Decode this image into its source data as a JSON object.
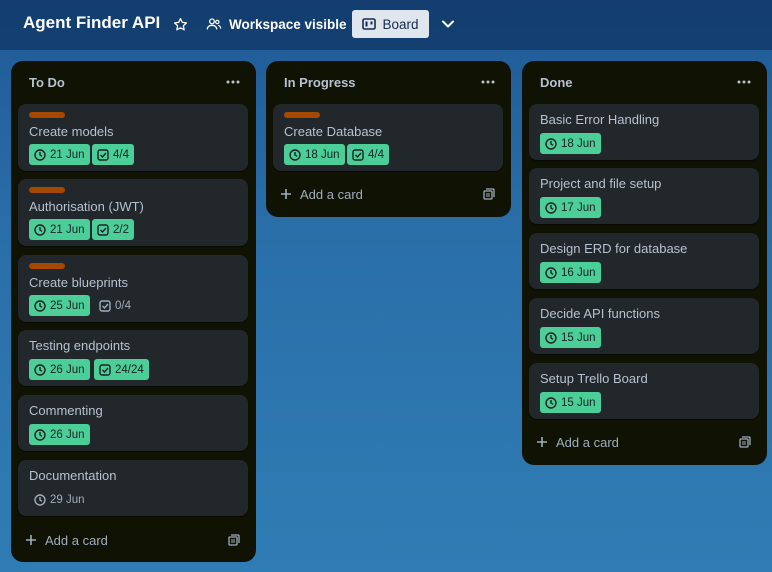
{
  "header": {
    "board_title": "Agent Finder API",
    "visibility_label": "Workspace visible",
    "view_label": "Board"
  },
  "lists": [
    {
      "title": "To Do",
      "add_card_label": "Add a card",
      "cards": [
        {
          "title": "Create models",
          "label_color": "#a54800",
          "due": "21 Jun",
          "checklist": "4/4",
          "checklist_complete": true
        },
        {
          "title": "Authorisation (JWT)",
          "label_color": "#a54800",
          "due": "21 Jun",
          "checklist": "2/2",
          "checklist_complete": true
        },
        {
          "title": "Create blueprints",
          "label_color": "#a54800",
          "due": "25 Jun",
          "checklist": "0/4",
          "checklist_complete": false
        },
        {
          "title": "Testing endpoints",
          "due": "26 Jun",
          "checklist": "24/24",
          "checklist_complete": true
        },
        {
          "title": "Commenting",
          "due": "26 Jun"
        },
        {
          "title": "Documentation",
          "due": "29 Jun",
          "due_complete": false
        }
      ]
    },
    {
      "title": "In Progress",
      "add_card_label": "Add a card",
      "cards": [
        {
          "title": "Create Database",
          "label_color": "#a54800",
          "due": "18 Jun",
          "checklist": "4/4",
          "checklist_complete": true
        }
      ]
    },
    {
      "title": "Done",
      "add_card_label": "Add a card",
      "cards": [
        {
          "title": "Basic Error Handling",
          "due": "18 Jun"
        },
        {
          "title": "Project and file setup",
          "due": "17 Jun"
        },
        {
          "title": "Design ERD for database",
          "due": "16 Jun"
        },
        {
          "title": "Decide API functions",
          "due": "15 Jun"
        },
        {
          "title": "Setup Trello Board",
          "due": "15 Jun"
        }
      ]
    }
  ],
  "colors": {
    "list_bg": "#101204",
    "card_bg": "#22272b",
    "label_orange": "#a54800",
    "badge_green": "#4bce97",
    "view_button_bg": "#dfe6ee"
  },
  "icons": {
    "star": "star-icon",
    "visibility": "people-icon",
    "board": "board-icon",
    "chevron": "chevron-down-icon",
    "menu": "ellipsis-icon",
    "due": "clock-icon",
    "checklist": "checkbox-icon",
    "add": "plus-icon",
    "template": "template-icon"
  }
}
